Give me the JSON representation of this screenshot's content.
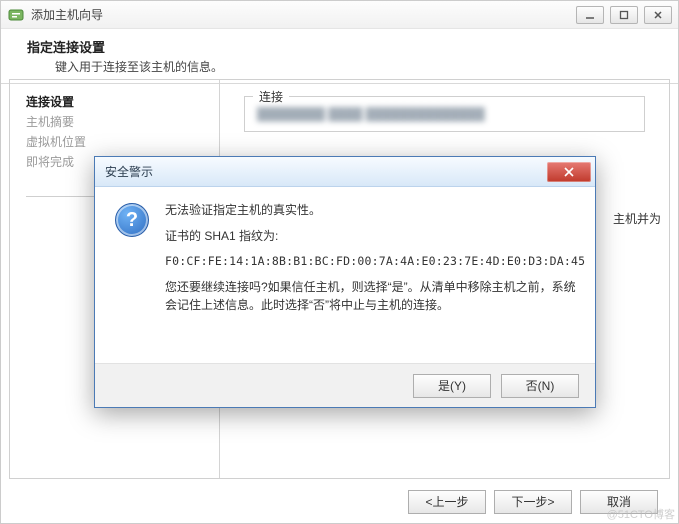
{
  "window": {
    "title": "添加主机向导"
  },
  "header": {
    "title": "指定连接设置",
    "subtitle": "键入用于连接至该主机的信息。"
  },
  "nav": {
    "items": [
      {
        "label": "连接设置",
        "active": true
      },
      {
        "label": "主机摘要",
        "active": false
      },
      {
        "label": "虚拟机位置",
        "active": false
      },
      {
        "label": "即将完成",
        "active": false
      }
    ]
  },
  "content": {
    "group_connection_legend": "连接",
    "partial_text": "主机并为"
  },
  "dialog": {
    "title": "安全警示",
    "line1": "无法验证指定主机的真实性。",
    "line2": "证书的 SHA1 指纹为:",
    "fingerprint": "F0:CF:FE:14:1A:8B:B1:BC:FD:00:7A:4A:E0:23:7E:4D:E0:D3:DA:45",
    "line3": "您还要继续连接吗?如果信任主机，则选择“是”。从清单中移除主机之前，系统会记住上述信息。此时选择“否”将中止与主机的连接。",
    "yes": "是(Y)",
    "no": "否(N)"
  },
  "footer": {
    "back": "<上一步",
    "next": "下一步>",
    "cancel": "取消"
  },
  "watermark": "@51CTO博客"
}
